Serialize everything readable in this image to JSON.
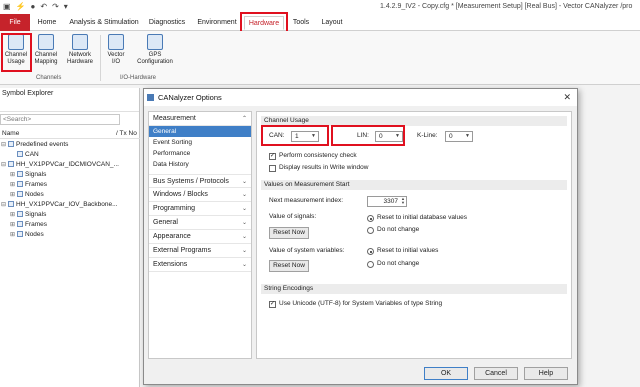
{
  "window": {
    "title": "1.4.2.9_IV2 - Copy.cfg * [Measurement Setup] [Real Bus] - Vector CANalyzer /pro",
    "quick_access": [
      "▣",
      "⚡",
      "●",
      "↶",
      "↷",
      "▾"
    ]
  },
  "ribbon": {
    "tabs": [
      "File",
      "Home",
      "Analysis & Stimulation",
      "Diagnostics",
      "Environment",
      "Hardware",
      "Tools",
      "Layout"
    ],
    "active_tab": "Hardware",
    "buttons": [
      {
        "label": "Channel Usage",
        "group": "Channels"
      },
      {
        "label": "Channel Mapping",
        "group": "Channels"
      },
      {
        "label": "Network Hardware",
        "group": "Channels"
      },
      {
        "label": "Vector I/O",
        "group": "I/O-Hardware"
      },
      {
        "label": "GPS Configuration",
        "group": "I/O-Hardware"
      }
    ],
    "groups": [
      "Channels",
      "I/O-Hardware"
    ]
  },
  "symbol_explorer": {
    "title": "Symbol Explorer",
    "search_placeholder": "<Search>",
    "col_name": "Name",
    "col_txno": "/ Tx No",
    "tree": [
      {
        "indent": 0,
        "toggle": "⊟",
        "label": "Predefined events"
      },
      {
        "indent": 1,
        "toggle": "",
        "label": "CAN"
      },
      {
        "indent": 0,
        "toggle": "⊟",
        "label": "HH_VX1PPVCar_IDCMIOVCAN_..."
      },
      {
        "indent": 1,
        "toggle": "⊞",
        "label": "Signals"
      },
      {
        "indent": 1,
        "toggle": "⊞",
        "label": "Frames"
      },
      {
        "indent": 1,
        "toggle": "⊞",
        "label": "Nodes"
      },
      {
        "indent": 0,
        "toggle": "⊟",
        "label": "HH_VX1PPVCar_IOV_Backbone..."
      },
      {
        "indent": 1,
        "toggle": "⊞",
        "label": "Signals"
      },
      {
        "indent": 1,
        "toggle": "⊞",
        "label": "Frames"
      },
      {
        "indent": 1,
        "toggle": "⊞",
        "label": "Nodes"
      }
    ]
  },
  "dialog": {
    "title": "CANalyzer Options",
    "close": "✕",
    "nav": {
      "measurement": "Measurement",
      "sub_items": [
        "General",
        "Event Sorting",
        "Performance",
        "Data History"
      ],
      "selected": "General",
      "groups": [
        "Bus Systems / Protocols",
        "Windows / Blocks",
        "Programming",
        "General",
        "Appearance",
        "External Programs",
        "Extensions"
      ]
    },
    "channel_usage": {
      "header": "Channel Usage",
      "can_label": "CAN:",
      "can_value": "1",
      "lin_label": "LIN:",
      "lin_value": "0",
      "kline_label": "K-Line:",
      "kline_value": "0",
      "consistency_label": "Perform consistency check",
      "consistency_checked": true,
      "display_label": "Display results in Write window",
      "display_checked": false
    },
    "values_start": {
      "header": "Values on Measurement Start",
      "next_index_label": "Next measurement index:",
      "next_index_value": "3307",
      "signals_label": "Value of signals:",
      "reset_now": "Reset Now",
      "reset_initial_db": "Reset to initial database values",
      "do_not_change": "Do not change",
      "sysvars_label": "Value of system variables:",
      "reset_initial": "Reset to initial values"
    },
    "string_encodings": {
      "header": "String Encodings",
      "unicode_label": "Use Unicode (UTF-8) for System Variables of type String",
      "unicode_checked": true
    },
    "footer": {
      "ok": "OK",
      "cancel": "Cancel",
      "help": "Help"
    }
  }
}
